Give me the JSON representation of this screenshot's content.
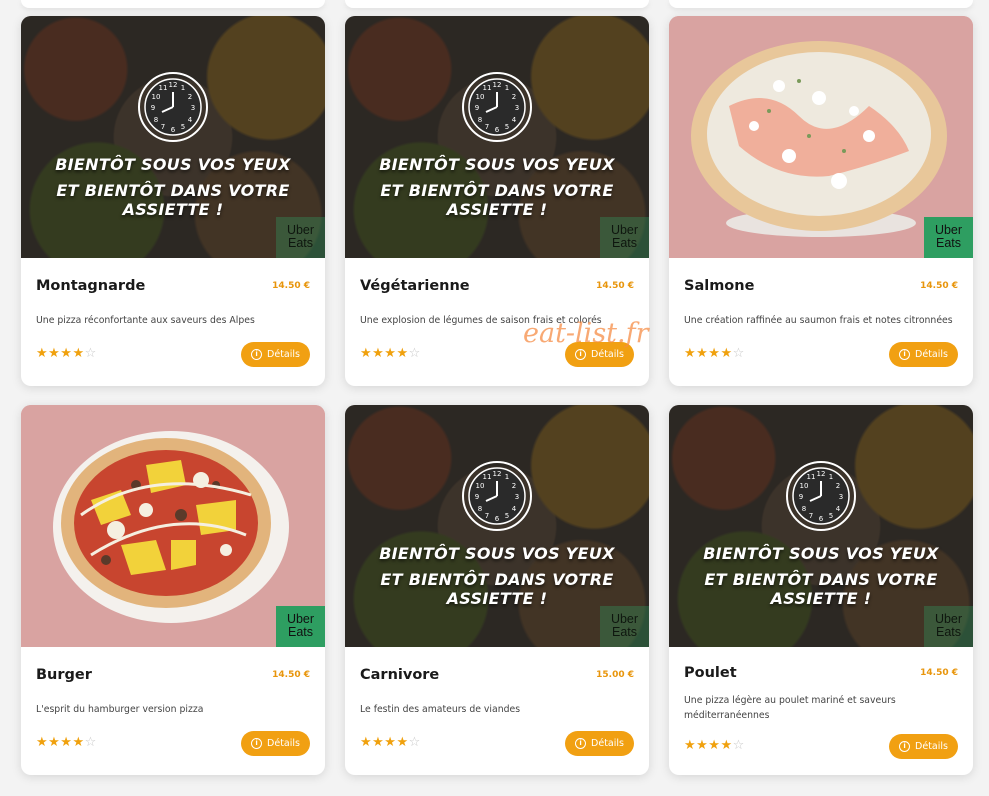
{
  "watermark": "eat-list.fr",
  "placeholder": {
    "line1": "BIENTÔT SOUS VOS YEUX",
    "line2": "ET BIENTÔT DANS VOTRE ASSIETTE !"
  },
  "badge": {
    "line1": "Uber",
    "line2": "Eats"
  },
  "details_label": "Détails",
  "cards": [
    {
      "name": "Montagnarde",
      "price": "14.50 €",
      "desc": "Une pizza réconfortante aux saveurs des Alpes",
      "rating": 4,
      "max": 5
    },
    {
      "name": "Végétarienne",
      "price": "14.50 €",
      "desc": "Une explosion de légumes de saison frais et colorés",
      "rating": 4,
      "max": 5
    },
    {
      "name": "Salmone",
      "price": "14.50 €",
      "desc": "Une création raffinée au saumon frais et notes citronnées",
      "rating": 4,
      "max": 5
    },
    {
      "name": "Burger",
      "price": "14.50 €",
      "desc": "L'esprit du hamburger version pizza",
      "rating": 4,
      "max": 5
    },
    {
      "name": "Carnivore",
      "price": "15.00 €",
      "desc": "Le festin des amateurs de viandes",
      "rating": 4,
      "max": 5
    },
    {
      "name": "Poulet",
      "price": "14.50 €",
      "desc": "Une pizza légère au poulet mariné et saveurs méditerranéennes",
      "rating": 4,
      "max": 5
    }
  ],
  "colors": {
    "accent": "#f1a012",
    "price": "#e8950b",
    "ubereats": "#2e9e61"
  }
}
